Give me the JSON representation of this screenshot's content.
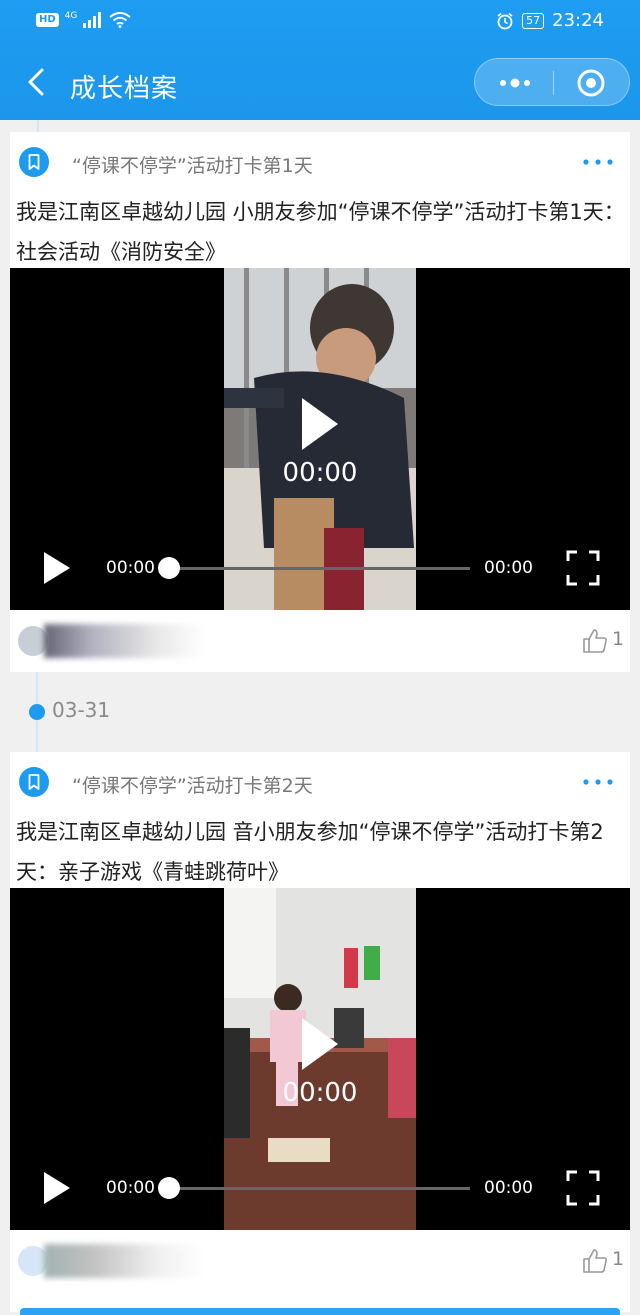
{
  "status_bar": {
    "network_badge": "HD",
    "network_type": "4G",
    "battery_level": "57",
    "time": "23:24"
  },
  "nav": {
    "title": "成长档案"
  },
  "posts": [
    {
      "activity_title": "“停课不停学”活动打卡第1天",
      "description": "我是江南区卓越幼儿园                    小朋友参加“停课不停学”活动打卡第1天：社会活动《消防安全》",
      "video": {
        "center_time": "00:00",
        "current_time": "00:00",
        "duration": "00:00",
        "progress": 0
      },
      "like_count": "1"
    },
    {
      "activity_title": "“停课不停学”活动打卡第2天",
      "description": "我是江南区卓越幼儿园                    音小朋友参加“停课不停学”活动打卡第2天：亲子游戏《青蛙跳荷叶》",
      "video": {
        "center_time": "00:00",
        "current_time": "00:00",
        "duration": "00:00",
        "progress": 0
      },
      "like_count": "1"
    }
  ],
  "timeline": {
    "date": "03-31"
  },
  "colors": {
    "brand_blue": "#1d9bf0",
    "timeline_dot": "#1d9bf0"
  }
}
